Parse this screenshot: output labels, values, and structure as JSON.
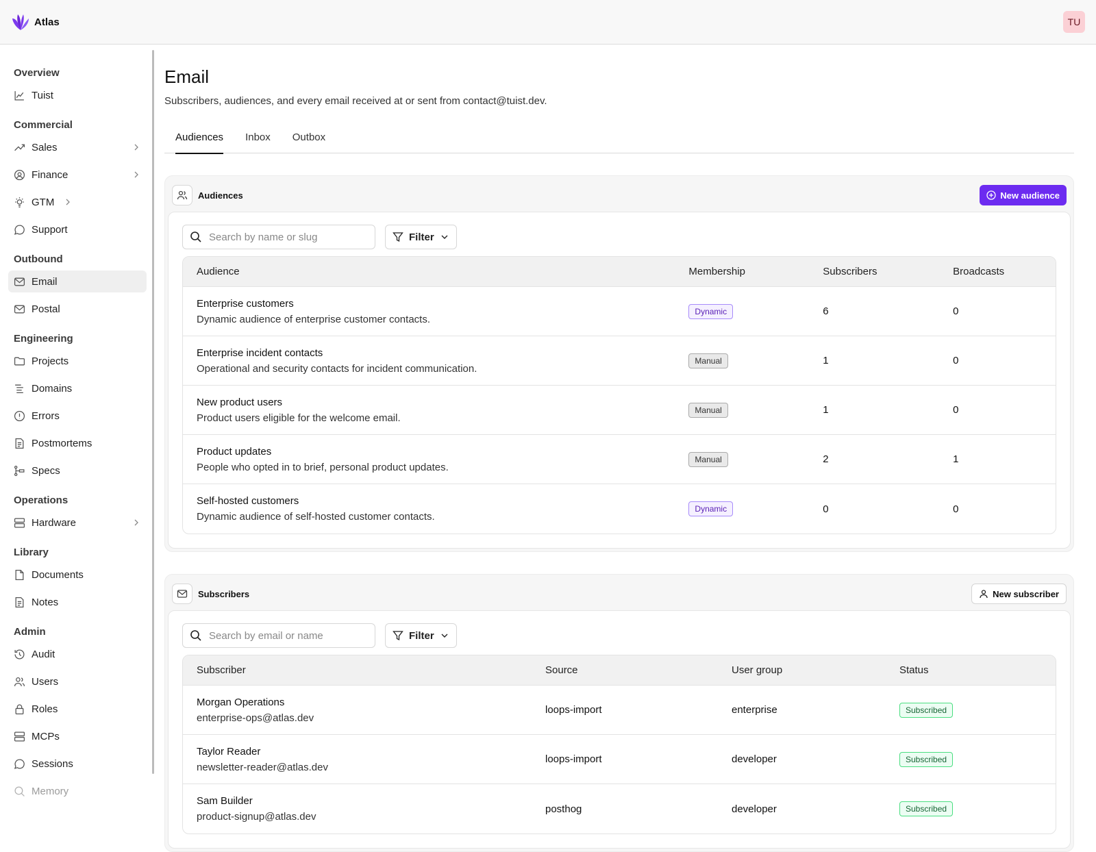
{
  "app": {
    "name": "Atlas",
    "avatar_initials": "TU",
    "accent": "#6c2bf0"
  },
  "sidebar": {
    "groups": [
      {
        "title": "Overview",
        "items": [
          {
            "label": "Tuist",
            "icon": "chart-icon"
          }
        ]
      },
      {
        "title": "Commercial",
        "items": [
          {
            "label": "Sales",
            "icon": "trend-icon",
            "chevron": true
          },
          {
            "label": "Finance",
            "icon": "finance-icon",
            "chevron": true
          },
          {
            "label": "GTM",
            "icon": "bulb-icon",
            "chevron": true
          },
          {
            "label": "Support",
            "icon": "chat-icon"
          }
        ]
      },
      {
        "title": "Outbound",
        "items": [
          {
            "label": "Email",
            "icon": "mail-icon",
            "active": true
          },
          {
            "label": "Postal",
            "icon": "mail-icon"
          }
        ]
      },
      {
        "title": "Engineering",
        "items": [
          {
            "label": "Projects",
            "icon": "folder-icon"
          },
          {
            "label": "Domains",
            "icon": "list-icon"
          },
          {
            "label": "Errors",
            "icon": "alert-icon"
          },
          {
            "label": "Postmortems",
            "icon": "doc-icon"
          },
          {
            "label": "Specs",
            "icon": "tree-icon"
          }
        ]
      },
      {
        "title": "Operations",
        "items": [
          {
            "label": "Hardware",
            "icon": "server-icon",
            "chevron": true
          }
        ]
      },
      {
        "title": "Library",
        "items": [
          {
            "label": "Documents",
            "icon": "file-icon"
          },
          {
            "label": "Notes",
            "icon": "doc-icon"
          }
        ]
      },
      {
        "title": "Admin",
        "items": [
          {
            "label": "Audit",
            "icon": "history-icon"
          },
          {
            "label": "Users",
            "icon": "users-icon"
          },
          {
            "label": "Roles",
            "icon": "lock-icon"
          },
          {
            "label": "MCPs",
            "icon": "server-icon"
          },
          {
            "label": "Sessions",
            "icon": "chat-icon"
          },
          {
            "label": "Memory",
            "icon": "search-icon"
          }
        ]
      }
    ]
  },
  "page": {
    "title": "Email",
    "subtitle": "Subscribers, audiences, and every email received at or sent from contact@tuist.dev.",
    "tabs": [
      "Audiences",
      "Inbox",
      "Outbox"
    ]
  },
  "audiences": {
    "heading": "Audiences",
    "new_button": "New audience",
    "search_placeholder": "Search by name or slug",
    "filter_label": "Filter",
    "columns": [
      "Audience",
      "Membership",
      "Subscribers",
      "Broadcasts"
    ],
    "rows": [
      {
        "name": "Enterprise customers",
        "description": "Dynamic audience of enterprise customer contacts.",
        "membership": "Dynamic",
        "subscribers": "6",
        "broadcasts": "0"
      },
      {
        "name": "Enterprise incident contacts",
        "description": "Operational and security contacts for incident communication.",
        "membership": "Manual",
        "subscribers": "1",
        "broadcasts": "0"
      },
      {
        "name": "New product users",
        "description": "Product users eligible for the welcome email.",
        "membership": "Manual",
        "subscribers": "1",
        "broadcasts": "0"
      },
      {
        "name": "Product updates",
        "description": "People who opted in to brief, personal product updates.",
        "membership": "Manual",
        "subscribers": "2",
        "broadcasts": "1"
      },
      {
        "name": "Self-hosted customers",
        "description": "Dynamic audience of self-hosted customer contacts.",
        "membership": "Dynamic",
        "subscribers": "0",
        "broadcasts": "0"
      }
    ]
  },
  "subscribers": {
    "heading": "Subscribers",
    "new_button": "New subscriber",
    "search_placeholder": "Search by email or name",
    "filter_label": "Filter",
    "columns": [
      "Subscriber",
      "Source",
      "User group",
      "Status"
    ],
    "rows": [
      {
        "name": "Morgan Operations",
        "email": "enterprise-ops@atlas.dev",
        "source": "loops-import",
        "group": "enterprise",
        "status": "Subscribed"
      },
      {
        "name": "Taylor Reader",
        "email": "newsletter-reader@atlas.dev",
        "source": "loops-import",
        "group": "developer",
        "status": "Subscribed"
      },
      {
        "name": "Sam Builder",
        "email": "product-signup@atlas.dev",
        "source": "posthog",
        "group": "developer",
        "status": "Subscribed"
      }
    ]
  }
}
